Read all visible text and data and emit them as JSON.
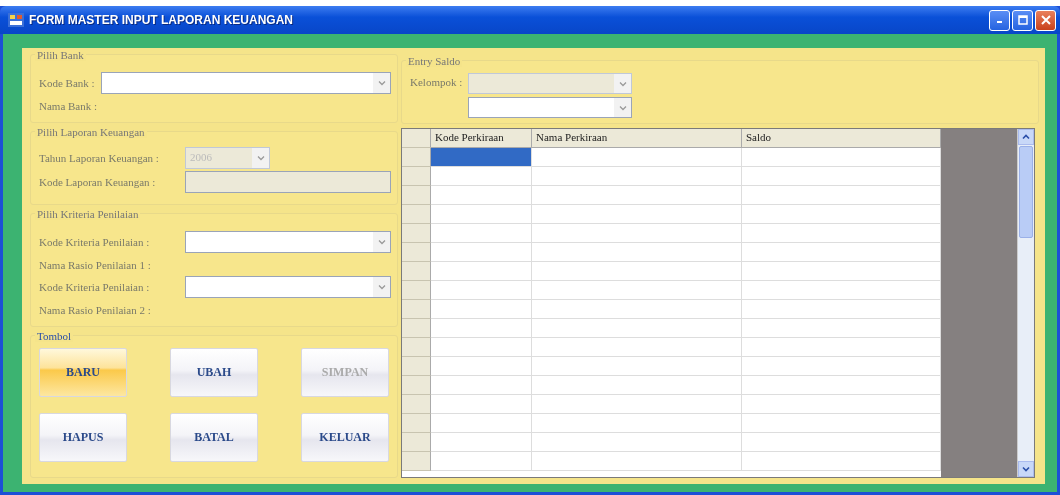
{
  "window": {
    "title": "FORM MASTER INPUT LAPORAN KEUANGAN"
  },
  "pilih_bank": {
    "title": "Pilih Bank",
    "fields": [
      {
        "kind": "combo",
        "label": "Kode Bank :",
        "disabled": false
      },
      {
        "kind": "label",
        "label": "Nama Bank :"
      }
    ]
  },
  "pilih_laporan": {
    "title": "Pilih Laporan Keuangan",
    "fields": [
      {
        "kind": "combo",
        "label": "Tahun Laporan Keuangan :",
        "value": "2006",
        "disabled": true,
        "short": true
      },
      {
        "kind": "text",
        "label": "Kode Laporan Keuangan   :",
        "disabled": true
      }
    ]
  },
  "pilih_kriteria": {
    "title": "Pilih Kriteria Penilaian",
    "fields": [
      {
        "kind": "combo",
        "label": "Kode Kriteria Penilaian   :",
        "disabled": false
      },
      {
        "kind": "label",
        "label": "Nama Rasio Penilaian 1 :"
      },
      {
        "kind": "combo",
        "label": "Kode Kriteria Penilaian   :",
        "disabled": false
      },
      {
        "kind": "label",
        "label": "Nama Rasio Penilaian 2 :"
      }
    ]
  },
  "tombol": {
    "title": "Tombol",
    "buttons": [
      {
        "label": "BARU",
        "highlighted": true,
        "disabled": false
      },
      {
        "label": "UBAH",
        "highlighted": false,
        "disabled": false
      },
      {
        "label": "SIMPAN",
        "highlighted": false,
        "disabled": true
      },
      {
        "label": "HAPUS",
        "highlighted": false,
        "disabled": false
      },
      {
        "label": "BATAL",
        "highlighted": false,
        "disabled": false
      },
      {
        "label": "KELUAR",
        "highlighted": false,
        "disabled": false
      }
    ]
  },
  "entry_saldo": {
    "title": "Entry Saldo",
    "kelompok_label": "Kelompok :",
    "combos": [
      {
        "disabled": true
      },
      {
        "disabled": false
      }
    ]
  },
  "grid": {
    "columns": [
      "Kode Perkiraan",
      "Nama Perkiraan",
      "Saldo"
    ],
    "rows": [
      {
        "selected": true
      },
      {
        "selected": false
      },
      {
        "selected": false
      },
      {
        "selected": false
      },
      {
        "selected": false
      },
      {
        "selected": false
      },
      {
        "selected": false
      },
      {
        "selected": false
      },
      {
        "selected": false
      },
      {
        "selected": false
      },
      {
        "selected": false
      },
      {
        "selected": false
      },
      {
        "selected": false
      },
      {
        "selected": false
      },
      {
        "selected": false
      },
      {
        "selected": false
      },
      {
        "selected": false
      }
    ]
  }
}
